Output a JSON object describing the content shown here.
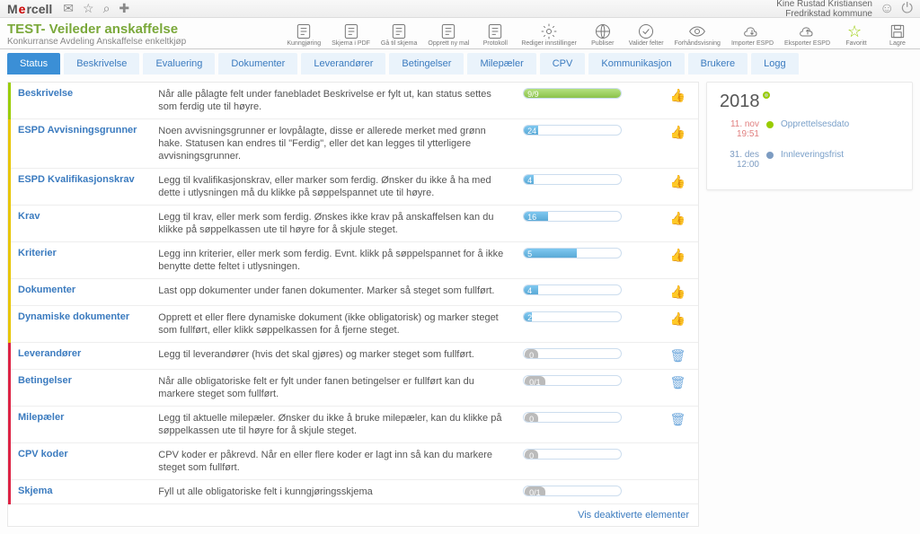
{
  "header": {
    "logo_parts": [
      "M",
      "e",
      "rcell"
    ],
    "user_name": "Kine Rustad Kristiansen",
    "user_org": "Fredrikstad kommune"
  },
  "title": {
    "main": "TEST- Veileder anskaffelse",
    "sub": "Konkurranse Avdeling Anskaffelse enkeltkjøp"
  },
  "toolbar": [
    {
      "label": "Kunngjøring",
      "key": "kunngjoring"
    },
    {
      "label": "Skjema i PDF",
      "key": "skjema-pdf"
    },
    {
      "label": "Gå til skjema",
      "key": "gaa-skjema"
    },
    {
      "label": "Opprett ny mal",
      "key": "ny-mal"
    },
    {
      "label": "Protokoll",
      "key": "protokoll"
    },
    {
      "label": "Rediger innstillinger",
      "key": "rediger"
    },
    {
      "label": "Publiser",
      "key": "publiser"
    },
    {
      "label": "Valider felter",
      "key": "valider"
    },
    {
      "label": "Forhåndsvisning",
      "key": "forhand"
    },
    {
      "label": "Importer ESPD",
      "key": "import"
    },
    {
      "label": "Eksporter ESPD",
      "key": "eksport"
    },
    {
      "label": "Favoritt",
      "key": "favoritt"
    },
    {
      "label": "Lagre",
      "key": "lagre"
    }
  ],
  "tabs": [
    "Status",
    "Beskrivelse",
    "Evaluering",
    "Dokumenter",
    "Leverandører",
    "Betingelser",
    "Milepæler",
    "CPV",
    "Kommunikasjon",
    "Brukere",
    "Logg"
  ],
  "steps": [
    {
      "k": "beskrivelse",
      "name": "Beskrivelse",
      "desc": "Når alle pålagte felt under fanebladet Beskrivelse er fylt ut, kan status settes som ferdig ute til høyre.",
      "badge": "9/9",
      "pct": 100,
      "fill": "g",
      "act": "thumb",
      "border": "green",
      "ncolor": "blue"
    },
    {
      "k": "espd-avv",
      "name": "ESPD Avvisningsgrunner",
      "desc": "Noen avvisningsgrunner er lovpålagte, disse er allerede merket med grønn hake. Statusen kan endres til \"Ferdig\", eller det kan legges til ytterligere avvisningsgrunner.",
      "badge": "24",
      "pct": 15,
      "fill": "b",
      "act": "thumb",
      "border": "yellow",
      "ncolor": "blue"
    },
    {
      "k": "espd-kval",
      "name": "ESPD Kvalifikasjonskrav",
      "desc": "Legg til kvalifikasjonskrav, eller marker som ferdig. Ønsker du ikke å ha med dette i utlysningen må du klikke på søppelspannet ute til høyre.",
      "badge": "4",
      "pct": 10,
      "fill": "b",
      "act": "thumb",
      "border": "yellow",
      "ncolor": "blue"
    },
    {
      "k": "krav",
      "name": "Krav",
      "desc": "Legg til krav, eller merk som ferdig. Ønskes ikke krav på anskaffelsen kan du klikke på søppelkassen ute til høyre for å skjule steget.",
      "badge": "16",
      "pct": 25,
      "fill": "b",
      "act": "thumb",
      "border": "yellow",
      "ncolor": "blue"
    },
    {
      "k": "kriterier",
      "name": "Kriterier",
      "desc": "Legg inn kriterier, eller merk som ferdig. Evnt. klikk på søppelspannet for å ikke benytte dette feltet i utlysningen.",
      "badge": "5",
      "pct": 55,
      "fill": "b",
      "act": "thumb",
      "border": "yellow",
      "ncolor": "blue"
    },
    {
      "k": "dokumenter",
      "name": "Dokumenter",
      "desc": "Last opp dokumenter under fanen dokumenter. Marker så steget som fullført.",
      "badge": "4",
      "pct": 15,
      "fill": "b",
      "act": "thumb",
      "border": "yellow",
      "ncolor": "blue"
    },
    {
      "k": "dyn-dok",
      "name": "Dynamiske dokumenter",
      "desc": "Opprett et eller flere dynamiske dokument (ikke obligatorisk) og marker steget som fullført, eller klikk søppelkassen for å fjerne steget.",
      "badge": "2",
      "pct": 8,
      "fill": "b",
      "act": "thumb",
      "border": "yellow",
      "ncolor": "blue"
    },
    {
      "k": "leverandorer",
      "name": "Leverandører",
      "desc": "Legg til leverandører (hvis det skal gjøres) og marker steget som fullført.",
      "badge": "0",
      "pct": 0,
      "fill": "grey",
      "act": "trash",
      "border": "red",
      "ncolor": "blue"
    },
    {
      "k": "betingelser",
      "name": "Betingelser",
      "desc": "Når alle obligatoriske felt er fylt under fanen betingelser er fullført kan du markere steget som fullført.",
      "badge": "0/1",
      "pct": 0,
      "fill": "grey",
      "act": "trash",
      "border": "red",
      "ncolor": "blue"
    },
    {
      "k": "milepaeler",
      "name": "Milepæler",
      "desc": "Legg til aktuelle milepæler. Ønsker du ikke å bruke milepæler, kan du klikke på søppelkassen ute til høyre for å skjule steget.",
      "badge": "0",
      "pct": 0,
      "fill": "grey",
      "act": "trash",
      "border": "red",
      "ncolor": "blue"
    },
    {
      "k": "cpv",
      "name": "CPV koder",
      "desc": "CPV koder er påkrevd. Når en eller flere koder er lagt inn så kan du markere steget som fullført.",
      "badge": "0",
      "pct": 0,
      "fill": "grey",
      "act": "none",
      "border": "red",
      "ncolor": "blue"
    },
    {
      "k": "skjema",
      "name": "Skjema",
      "desc": "Fyll ut alle obligatoriske felt i kunngjøringsskjema",
      "badge": "0/1",
      "pct": 0,
      "fill": "grey",
      "act": "none",
      "border": "red",
      "ncolor": "blue"
    }
  ],
  "footer_link": "Vis deaktiverte elementer",
  "timeline": {
    "year": "2018",
    "items": [
      {
        "date": "11. nov",
        "time": "19:51",
        "label": "Opprettelsesdato",
        "color": "g",
        "dcolor": "d"
      },
      {
        "date": "31. des",
        "time": "12:00",
        "label": "Innleveringsfrist",
        "color": "b",
        "dcolor": "blue"
      }
    ]
  }
}
